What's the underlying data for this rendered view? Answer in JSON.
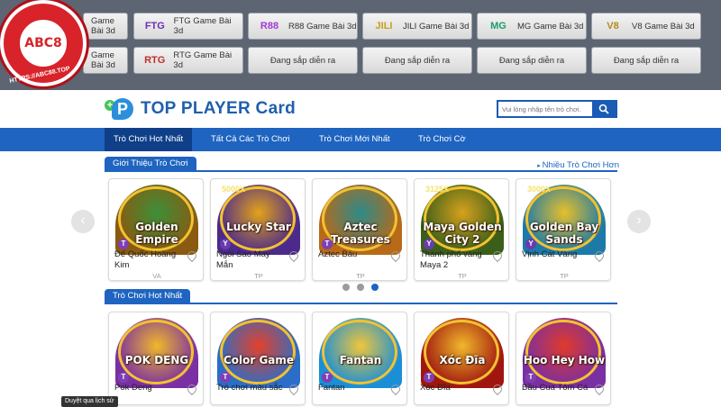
{
  "providers_row1": [
    {
      "label": "Game Bài 3d",
      "logo": "",
      "logo_color": "#d33",
      "logo_bg": "#f5f5f5"
    },
    {
      "label": "FTG Game Bài 3d",
      "logo": "FTG",
      "logo_color": "#6b2fb3",
      "logo_bg": "#f5f5f5"
    },
    {
      "label": "R88 Game Bài 3d",
      "logo": "R88",
      "logo_color": "#a23ad6",
      "logo_bg": "#f5f5f5"
    },
    {
      "label": "JILI Game Bài 3d",
      "logo": "JILI",
      "logo_color": "#c9a01b",
      "logo_bg": "#f5f5f5"
    },
    {
      "label": "MG Game Bài 3d",
      "logo": "MG",
      "logo_color": "#1f9c69",
      "logo_bg": "#f5f5f5"
    },
    {
      "label": "V8 Game Bài 3d",
      "logo": "V8",
      "logo_color": "#b58b1c",
      "logo_bg": "#f5f5f5"
    }
  ],
  "providers_row2": [
    {
      "label": "Game Bài 3d",
      "logo": ""
    },
    {
      "label": "RTG Game Bài 3d",
      "logo": "RTG"
    },
    {
      "label": "Đang sắp diễn ra",
      "logo": ""
    },
    {
      "label": "Đang sắp diễn ra",
      "logo": ""
    },
    {
      "label": "Đang sắp diễn ra",
      "logo": ""
    },
    {
      "label": "Đang sắp diễn ra",
      "logo": ""
    }
  ],
  "badge": {
    "text": "ABC8",
    "url": "HTTPS://ABC88.TOP"
  },
  "header": {
    "logo_letter": "P",
    "logo_plus": "+",
    "site_title": "TOP PLAYER Card",
    "search_placeholder": "Vui lòng nhập tên trò chơi."
  },
  "nav": {
    "items": [
      "Trò Chơi Hot Nhất",
      "Tất Cả Các Trò Chơi",
      "Trò Chơi Mới Nhất",
      "Trò Chơi Cờ"
    ]
  },
  "section_intro": {
    "title": "Giới Thiệu Trò Chơi",
    "more": "Nhiều Trò Chơi Hơn",
    "cards": [
      {
        "art": "Golden Empire",
        "name": "Đế Quốc Hoàng Kim",
        "provider": "VA",
        "bg": "#8a5a10",
        "accent": "#3d8f3a",
        "multi": ""
      },
      {
        "art": "Lucky Star",
        "name": "Ngôi Sao May Mắn",
        "provider": "TP",
        "bg": "#4b2a8c",
        "accent": "#e3a21a",
        "multi": "5000X"
      },
      {
        "art": "Aztec Treasures",
        "name": "Aztec Báu",
        "provider": "TP",
        "bg": "#b86a18",
        "accent": "#2d8a8a",
        "multi": ""
      },
      {
        "art": "Maya Golden City 2",
        "name": "Thành phố vàng Maya 2",
        "provider": "TP",
        "bg": "#3b5f1a",
        "accent": "#d6a11c",
        "multi": "3125X"
      },
      {
        "art": "Golden Bay Sands",
        "name": "Vịnh Cát Vàng",
        "provider": "TP",
        "bg": "#1d7aa8",
        "accent": "#e7c02a",
        "multi": "3000X"
      }
    ]
  },
  "section_hot": {
    "title": "Trò Chơi Hot Nhất",
    "cards": [
      {
        "art": "POK DENG",
        "name": "Pok Deng",
        "bg": "#7a2fa3",
        "accent": "#f0b82a"
      },
      {
        "art": "Color Game",
        "name": "Trò chơi màu sắc",
        "bg": "#2b6ec7",
        "accent": "#e5402a"
      },
      {
        "art": "Fantan",
        "name": "Fantan",
        "bg": "#1a8fd8",
        "accent": "#f0c63a"
      },
      {
        "art": "Xóc Đĩa",
        "name": "Xóc Đĩa",
        "bg": "#a0160f",
        "accent": "#f0b82a"
      },
      {
        "art": "Hoo Hey How",
        "name": "Bầu Cua Tôm Cá",
        "bg": "#7a2fa3",
        "accent": "#e03a2a"
      }
    ]
  },
  "tooltip": "Duyệt qua lịch sử"
}
